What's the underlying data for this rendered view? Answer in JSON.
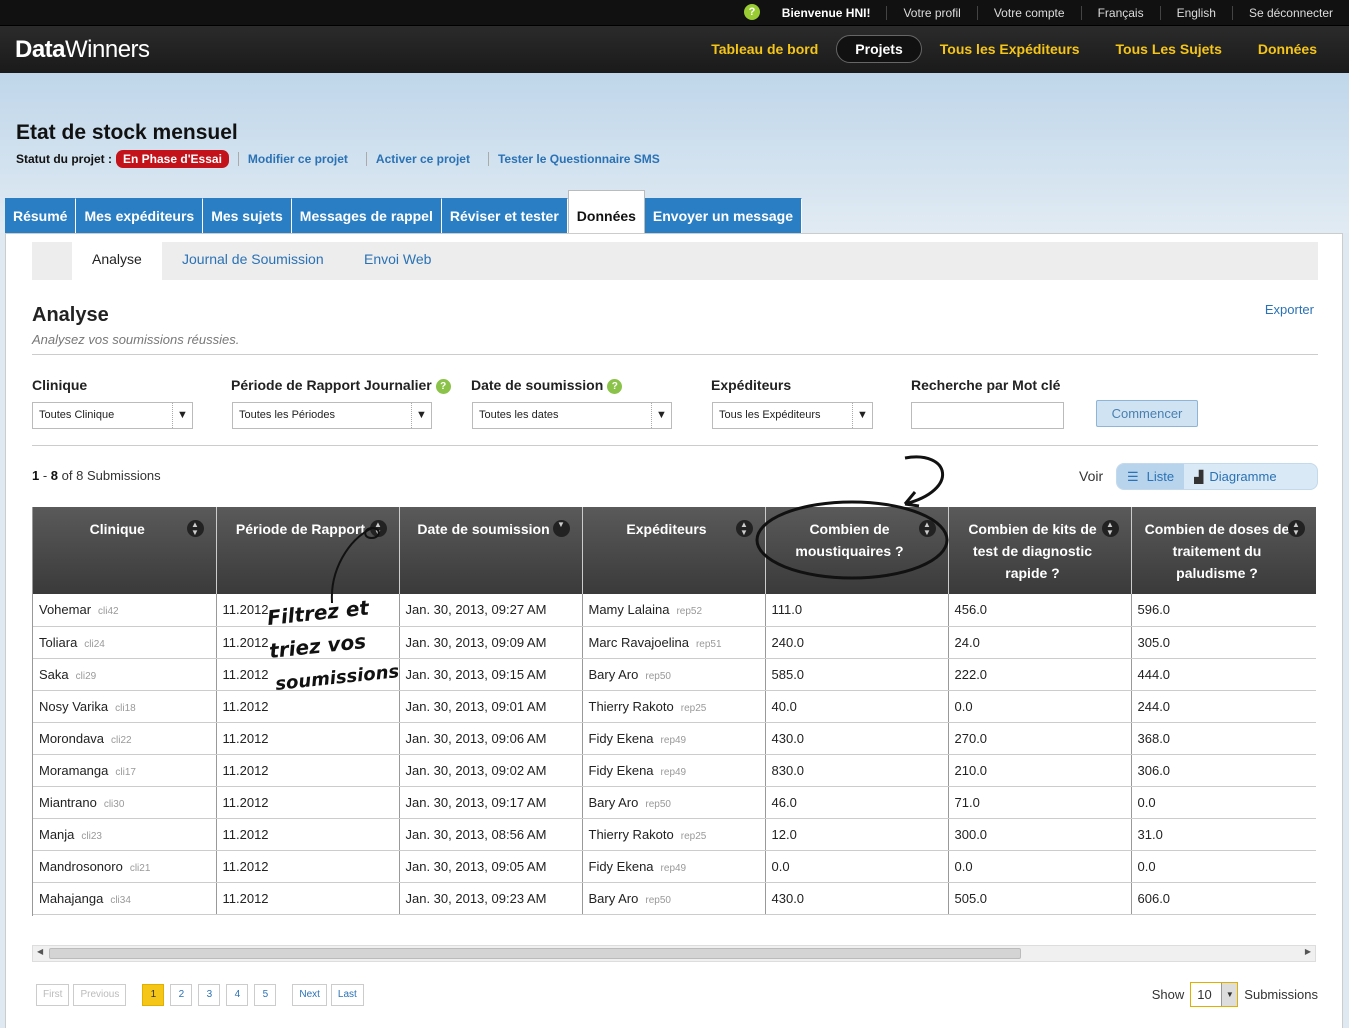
{
  "topbar": {
    "welcome": "Bienvenue HNI!",
    "items": [
      "Votre profil",
      "Votre compte",
      "Français",
      "English",
      "Se déconnecter"
    ]
  },
  "logo": {
    "bold": "Data",
    "rest": "Winners"
  },
  "mainnav": [
    "Tableau de bord",
    "Projets",
    "Tous les Expéditeurs",
    "Tous Les Sujets",
    "Données"
  ],
  "project": {
    "title": "Etat de stock mensuel",
    "status_label": "Statut du projet :",
    "status": "En Phase d'Essai",
    "links": [
      "Modifier ce projet",
      "Activer ce projet",
      "Tester le Questionnaire SMS"
    ]
  },
  "tabs": [
    "Résumé",
    "Mes expéditeurs",
    "Mes sujets",
    "Messages de rappel",
    "Réviser et tester",
    "Données",
    "Envoyer un message"
  ],
  "subtabs": [
    "Analyse",
    "Journal de Soumission",
    "Envoi Web"
  ],
  "analysis": {
    "title": "Analyse",
    "subtitle": "Analysez vos soumissions réussies.",
    "export": "Exporter"
  },
  "filters": {
    "labels": [
      "Clinique",
      "Période de Rapport Journalier",
      "Date de soumission",
      "Expéditeurs",
      "Recherche par Mot clé"
    ],
    "values": [
      "Toutes Clinique",
      "Toutes les Périodes",
      "Toutes les dates",
      "Tous les Expéditeurs"
    ],
    "button": "Commencer"
  },
  "count": {
    "range_start": "1",
    "range_end": "8",
    "total": "8",
    "label": "Submissions"
  },
  "view": {
    "label": "Voir",
    "list": "Liste",
    "chart": "Diagramme"
  },
  "table": {
    "headers": [
      "Clinique",
      "Période de Rapport",
      "Date de soumission",
      "Expéditeurs",
      "Combien de moustiquaires ?",
      "Combien de kits de test de diagnostic rapide ?",
      "Combien de doses de traitement du paludisme ?"
    ],
    "rows": [
      {
        "clinic": "Vohemar",
        "clinic_code": "cli42",
        "period": "11.2012",
        "date": "Jan. 30, 2013, 09:27 AM",
        "sender": "Mamy Lalaina",
        "sender_code": "rep52",
        "nets": "111.0",
        "kits": "456.0",
        "doses": "596.0"
      },
      {
        "clinic": "Toliara",
        "clinic_code": "cli24",
        "period": "11.2012",
        "date": "Jan. 30, 2013, 09:09 AM",
        "sender": "Marc Ravajoelina",
        "sender_code": "rep51",
        "nets": "240.0",
        "kits": "24.0",
        "doses": "305.0"
      },
      {
        "clinic": "Saka",
        "clinic_code": "cli29",
        "period": "11.2012",
        "date": "Jan. 30, 2013, 09:15 AM",
        "sender": "Bary Aro",
        "sender_code": "rep50",
        "nets": "585.0",
        "kits": "222.0",
        "doses": "444.0"
      },
      {
        "clinic": "Nosy Varika",
        "clinic_code": "cli18",
        "period": "11.2012",
        "date": "Jan. 30, 2013, 09:01 AM",
        "sender": "Thierry Rakoto",
        "sender_code": "rep25",
        "nets": "40.0",
        "kits": "0.0",
        "doses": "244.0"
      },
      {
        "clinic": "Morondava",
        "clinic_code": "cli22",
        "period": "11.2012",
        "date": "Jan. 30, 2013, 09:06 AM",
        "sender": "Fidy Ekena",
        "sender_code": "rep49",
        "nets": "430.0",
        "kits": "270.0",
        "doses": "368.0"
      },
      {
        "clinic": "Moramanga",
        "clinic_code": "cli17",
        "period": "11.2012",
        "date": "Jan. 30, 2013, 09:02 AM",
        "sender": "Fidy Ekena",
        "sender_code": "rep49",
        "nets": "830.0",
        "kits": "210.0",
        "doses": "306.0"
      },
      {
        "clinic": "Miantrano",
        "clinic_code": "cli30",
        "period": "11.2012",
        "date": "Jan. 30, 2013, 09:17 AM",
        "sender": "Bary Aro",
        "sender_code": "rep50",
        "nets": "46.0",
        "kits": "71.0",
        "doses": "0.0"
      },
      {
        "clinic": "Manja",
        "clinic_code": "cli23",
        "period": "11.2012",
        "date": "Jan. 30, 2013, 08:56 AM",
        "sender": "Thierry Rakoto",
        "sender_code": "rep25",
        "nets": "12.0",
        "kits": "300.0",
        "doses": "31.0"
      },
      {
        "clinic": "Mandrosonoro",
        "clinic_code": "cli21",
        "period": "11.2012",
        "date": "Jan. 30, 2013, 09:05 AM",
        "sender": "Fidy Ekena",
        "sender_code": "rep49",
        "nets": "0.0",
        "kits": "0.0",
        "doses": "0.0"
      },
      {
        "clinic": "Mahajanga",
        "clinic_code": "cli34",
        "period": "11.2012",
        "date": "Jan. 30, 2013, 09:23 AM",
        "sender": "Bary Aro",
        "sender_code": "rep50",
        "nets": "430.0",
        "kits": "505.0",
        "doses": "606.0"
      }
    ]
  },
  "pagination": {
    "first": "First",
    "previous": "Previous",
    "pages": [
      "1",
      "2",
      "3",
      "4",
      "5"
    ],
    "current": "1",
    "next": "Next",
    "last": "Last"
  },
  "show": {
    "label": "Show",
    "value": "10",
    "suffix": "Submissions"
  },
  "annotation": {
    "text": [
      "Filtrez et",
      "triez vos",
      "soumissions"
    ]
  },
  "colors": {
    "accent": "#2a7ec4",
    "nav": "#f5c518",
    "badge": "#c4121a"
  }
}
